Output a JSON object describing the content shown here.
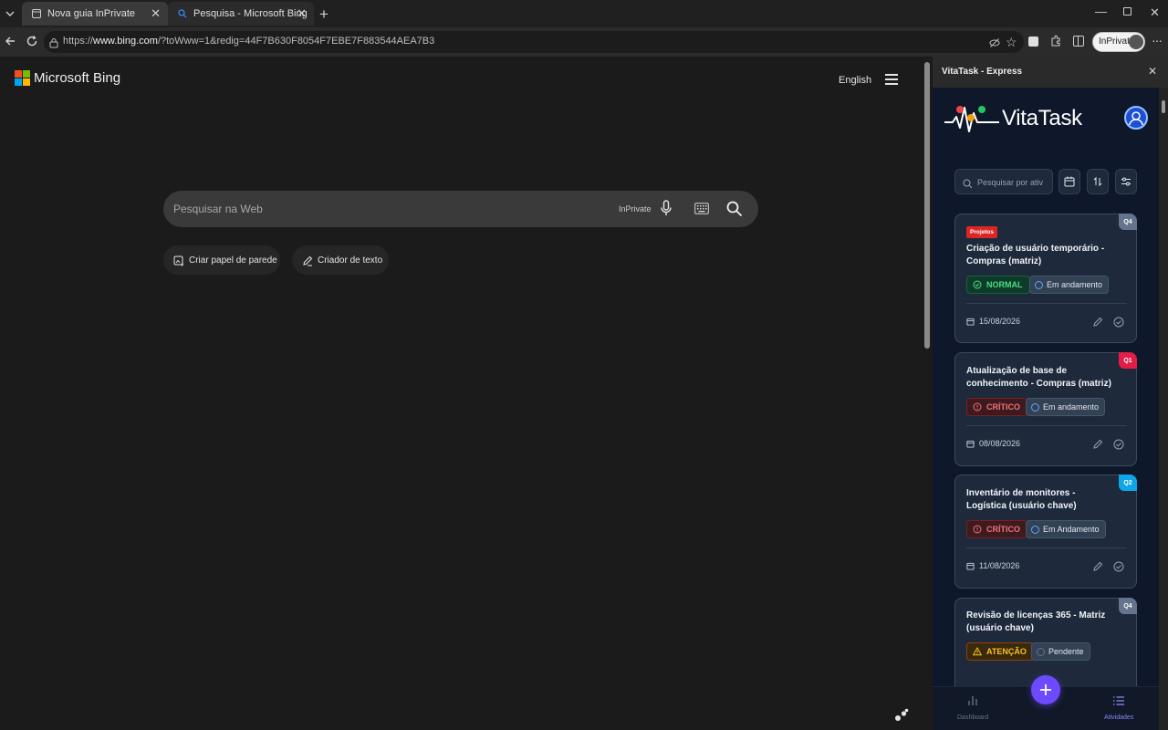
{
  "browser": {
    "tabs": [
      {
        "title": "Nova guia InPrivate",
        "active": false
      },
      {
        "title": "Pesquisa - Microsoft Bing",
        "active": true
      }
    ],
    "url_prefix": "https://",
    "url_host": "www.bing.com",
    "url_rest": "/?toWww=1&redig=44F7B630F8054F7EBE7F883544AEA7B3",
    "inprivate_label": "InPrivate"
  },
  "bing": {
    "logo_text": "Microsoft Bing",
    "language": "English",
    "search_placeholder": "Pesquisar na Web",
    "inprivate_tag": "InPrivate",
    "chips": [
      "Criar papel de parede",
      "Criador de texto"
    ]
  },
  "sidepanel": {
    "title": "VitaTask - Express",
    "app_name": "VitaTask",
    "search_placeholder": "Pesquisar por ativ",
    "tasks": [
      {
        "tag": "Projetos",
        "title": "Criação de usuário temporário - Compras (matriz)",
        "quadrant": "Q4",
        "priority": "NORMAL",
        "status": "Em andamento",
        "date": "15/08/2026"
      },
      {
        "tag": "",
        "title": "Atualização de base de conhecimento - Compras (matriz)",
        "quadrant": "Q1",
        "priority": "CRÍTICO",
        "status": "Em andamento",
        "date": "08/08/2026"
      },
      {
        "tag": "",
        "title": "Inventário de monitores - Logística (usuário chave)",
        "quadrant": "Q2",
        "priority": "CRÍTICO",
        "status": "Em Andamento",
        "date": "11/08/2026"
      },
      {
        "tag": "",
        "title": "Revisão de licenças 365 - Matriz (usuário chave)",
        "quadrant": "Q4",
        "priority": "ATENÇÃO",
        "status": "Pendente",
        "date": ""
      }
    ],
    "nav": {
      "dashboard": "Dashboard",
      "activities": "Atividades"
    }
  },
  "colors": {
    "accent": "#6d4aff",
    "critical": "#ef4444",
    "normal": "#22c55e",
    "warning": "#f59e0b",
    "q1": "#e11d48",
    "q2": "#0ea5e9",
    "q4": "#64748b"
  }
}
